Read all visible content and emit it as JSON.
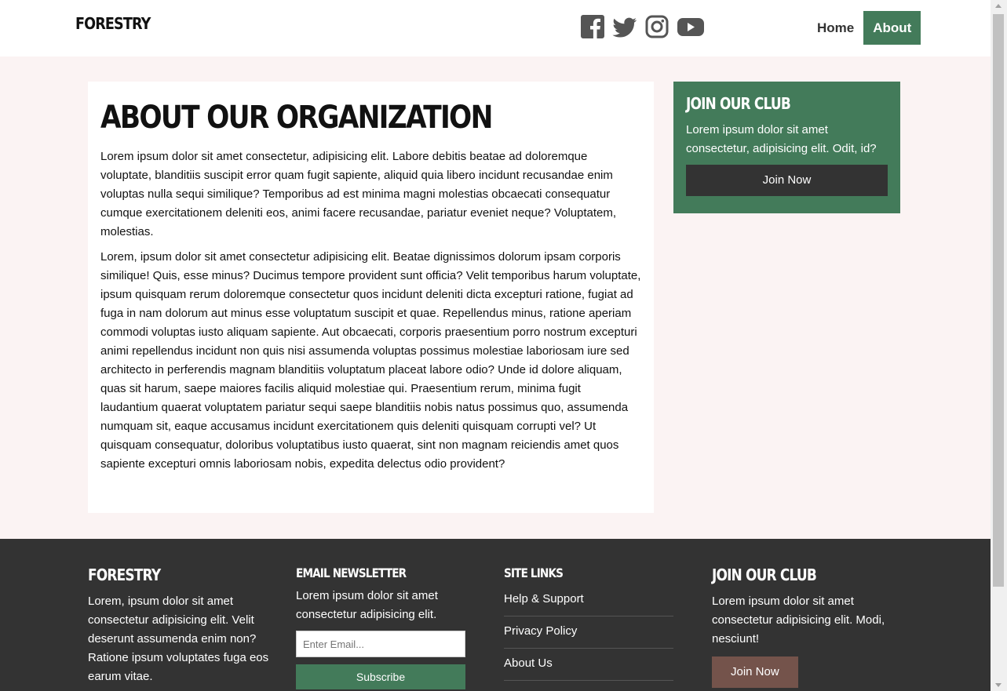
{
  "header": {
    "logo": "FORESTRY",
    "social_icons": [
      "facebook-icon",
      "twitter-icon",
      "instagram-icon",
      "youtube-icon"
    ],
    "nav": [
      {
        "label": "Home",
        "active": false
      },
      {
        "label": "About",
        "active": true
      }
    ]
  },
  "article": {
    "title": "ABOUT OUR ORGANIZATION",
    "paragraphs": [
      "Lorem ipsum dolor sit amet consectetur, adipisicing elit. Labore debitis beatae ad doloremque voluptate, blanditiis suscipit error quam fugit sapiente, aliquid quia libero incidunt recusandae enim voluptas nulla sequi similique? Temporibus ad est minima magni molestias obcaecati consequatur cumque exercitationem deleniti eos, animi facere recusandae, pariatur eveniet neque? Voluptatem, molestias.",
      "Lorem, ipsum dolor sit amet consectetur adipisicing elit. Beatae dignissimos dolorum ipsam corporis similique! Quis, esse minus? Ducimus tempore provident sunt officia? Velit temporibus harum voluptate, ipsum quisquam rerum doloremque consectetur quos incidunt deleniti dicta excepturi ratione, fugiat ad fuga in nam dolorum aut minus esse voluptatum suscipit et quae. Repellendus minus, ratione aperiam commodi voluptas iusto aliquam sapiente. Aut obcaecati, corporis praesentium porro nostrum excepturi animi repellendus incidunt non quis nisi assumenda voluptas possimus molestiae laboriosam iure sed architecto in perferendis magnam blanditiis voluptatum placeat labore odio? Unde id dolore aliquam, quas sit harum, saepe maiores facilis aliquid molestiae qui. Praesentium rerum, minima fugit laudantium quaerat voluptatem pariatur sequi saepe blanditiis nobis natus possimus quo, assumenda numquam sit, eaque accusamus incidunt exercitationem quis deleniti quisquam corrupti vel? Ut quisquam consequatur, doloribus voluptatibus iusto quaerat, sint non magnam reiciendis amet quos sapiente excepturi omnis laboriosam nobis, expedita delectus odio provident?"
    ]
  },
  "sidebar_club": {
    "title": "JOIN OUR CLUB",
    "text": "Lorem ipsum dolor sit amet consectetur, adipisicing elit. Odit, id?",
    "button": "Join Now"
  },
  "footer": {
    "about": {
      "title": "FORESTRY",
      "text": "Lorem, ipsum dolor sit amet consectetur adipisicing elit. Velit deserunt assumenda enim non? Ratione ipsum voluptates fuga eos earum vitae."
    },
    "newsletter": {
      "title": "EMAIL NEWSLETTER",
      "text": "Lorem ipsum dolor sit amet consectetur adipisicing elit.",
      "placeholder": "Enter Email...",
      "button": "Subscribe"
    },
    "site_links": {
      "title": "SITE LINKS",
      "links": [
        "Help & Support",
        "Privacy Policy",
        "About Us"
      ]
    },
    "club": {
      "title": "JOIN OUR CLUB",
      "text": "Lorem ipsum dolor sit amet consectetur adipisicing elit. Modi, nesciunt!",
      "button": "Join Now"
    }
  },
  "colors": {
    "accent_green": "#437b5a",
    "dark": "#333333",
    "footer_button": "#74534b",
    "main_bg": "#fbf3f3"
  }
}
